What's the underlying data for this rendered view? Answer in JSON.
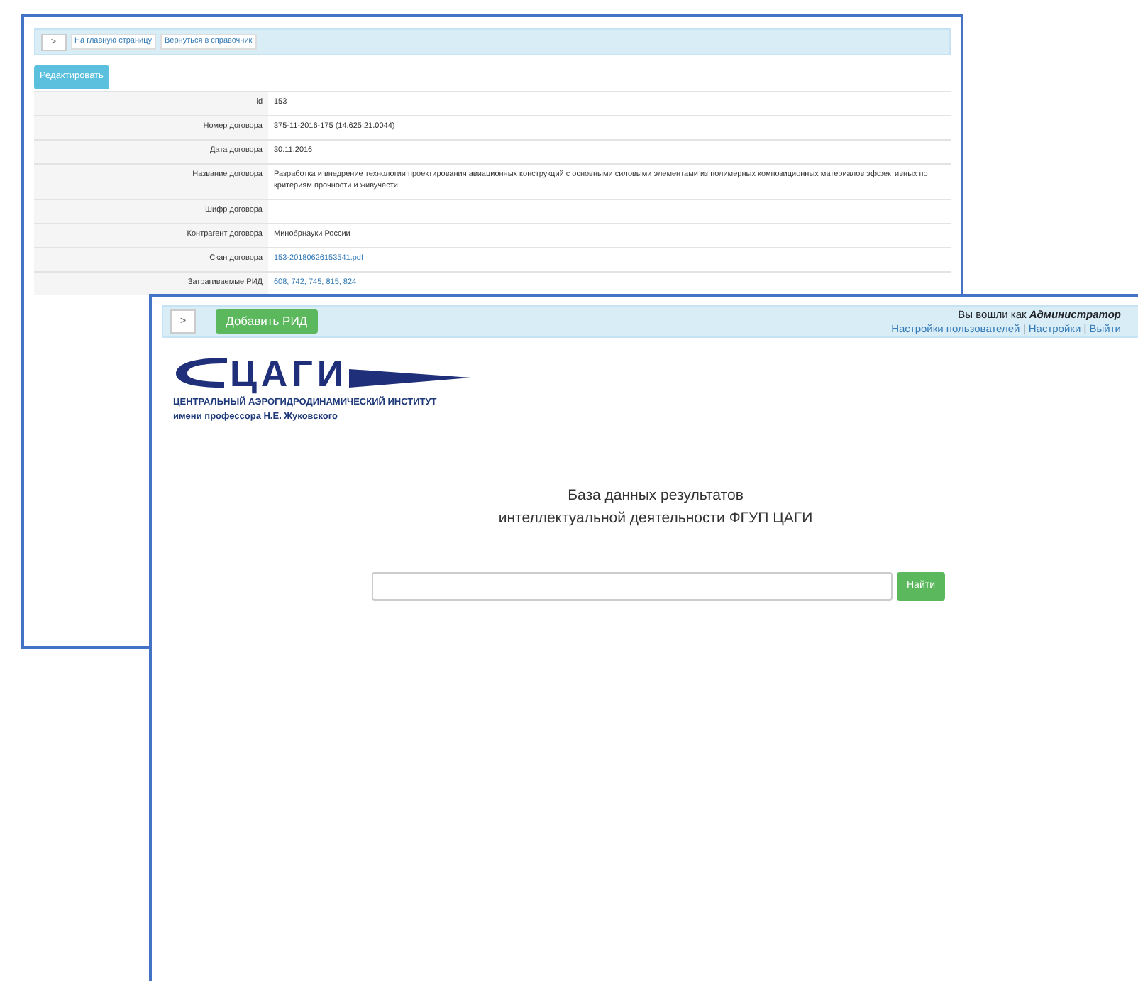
{
  "back_window": {
    "nav": {
      "toggle": ">",
      "links": [
        "На главную страницу",
        "Вернуться в справочник"
      ]
    },
    "edit_button": "Редактировать",
    "fields": [
      {
        "kind": "text",
        "label": "id",
        "value": "153"
      },
      {
        "kind": "text",
        "label": "Номер договора",
        "value": "375-11-2016-175 (14.625.21.0044)"
      },
      {
        "kind": "text",
        "label": "Дата договора",
        "value": "30.11.2016"
      },
      {
        "kind": "text",
        "label": "Название договора",
        "value": "Разработка и внедрение технологии проектирования авиационных конструкций с основными силовыми элементами из полимерных композиционных материалов эффективных по критериям прочности и живучести"
      },
      {
        "kind": "text",
        "label": "Шифр договора"
      },
      {
        "kind": "text",
        "label": "Контрагент договора",
        "value": "Минобрнауки России"
      },
      {
        "kind": "link",
        "label": "Скан договора",
        "value": "153-20180626153541.pdf"
      },
      {
        "kind": "link",
        "label": "Затрагиваемые РИД",
        "value": "608, 742, 745, 815, 824"
      }
    ]
  },
  "front_window": {
    "nav": {
      "toggle": ">",
      "add_button": "Добавить РИД",
      "login": "Вы вошли как **Администратор**",
      "links": [
        "Настройки пользователей",
        "Настройки",
        "Выйти"
      ],
      "separator": "|"
    },
    "logo": {
      "mark": "ЦАГИ",
      "line1": "ЦЕНТРАЛЬНЫЙ АЭРОГИДРОДИНАМИЧЕСКИЙ ИНСТИТУТ",
      "line2": "имени профессора Н.Е. Жуковского"
    },
    "title_lines": [
      "База данных результатов",
      "интеллектуальной деятельности ФГУП ЦАГИ"
    ],
    "search": {
      "button": "Найти"
    }
  }
}
